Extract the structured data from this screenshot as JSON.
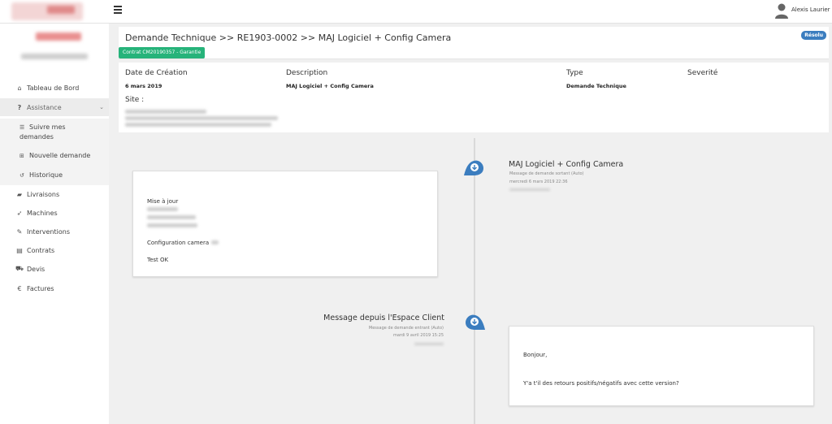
{
  "topbar": {
    "user_name": "Alexis Laurier"
  },
  "sidebar": {
    "items": [
      {
        "label": "Tableau de Bord",
        "icon": "home-icon"
      },
      {
        "label": "Assistance",
        "icon": "question-icon"
      },
      {
        "label": "Livraisons",
        "icon": "truck-icon"
      },
      {
        "label": "Machines",
        "icon": "rocket-icon"
      },
      {
        "label": "Interventions",
        "icon": "wrench-icon"
      },
      {
        "label": "Contrats",
        "icon": "briefcase-icon"
      },
      {
        "label": "Devis",
        "icon": "cart-icon"
      },
      {
        "label": "Factures",
        "icon": "euro-icon"
      }
    ],
    "subitems": [
      {
        "label_line1": "Suivre mes",
        "label_line2": "demandes",
        "icon": "list-icon"
      },
      {
        "label": "Nouvelle demande",
        "icon": "plus-square-icon"
      },
      {
        "label": "Historique",
        "icon": "history-icon"
      }
    ]
  },
  "ticket": {
    "title": "Demande Technique >> RE1903-0002 >> MAJ Logiciel + Config Camera",
    "contract": "Contrat CM20190357 - Garantie",
    "status": "Résolu",
    "labels": {
      "date": "Date de Création",
      "description": "Description",
      "type": "Type",
      "severity": "Severité",
      "site": "Site :"
    },
    "values": {
      "date": "6 mars 2019",
      "description": "MAJ Logiciel + Config Camera",
      "type": "Demande Technique"
    }
  },
  "timeline": [
    {
      "title": "MAJ Logiciel + Config Camera",
      "meta1": "Message de demande sortant (Auto)",
      "meta2": "mercredi 6 mars 2019 22:36",
      "body": {
        "line1": "Mise à jour",
        "line2": "Configuration camera",
        "line3": "Test OK"
      }
    },
    {
      "title": "Message depuis l'Espace Client",
      "meta1": "Message de demande entrant (Auto)",
      "meta2": "mardi 9 avril 2019 15:25",
      "body": {
        "line1": "Bonjour,",
        "line2": "Y'a t'il des retours positifs/négatifs avec cette version?"
      }
    }
  ],
  "colors": {
    "accent": "#3b7dbf",
    "contract_badge": "#26b37a",
    "status_badge": "#3b7dbf"
  }
}
